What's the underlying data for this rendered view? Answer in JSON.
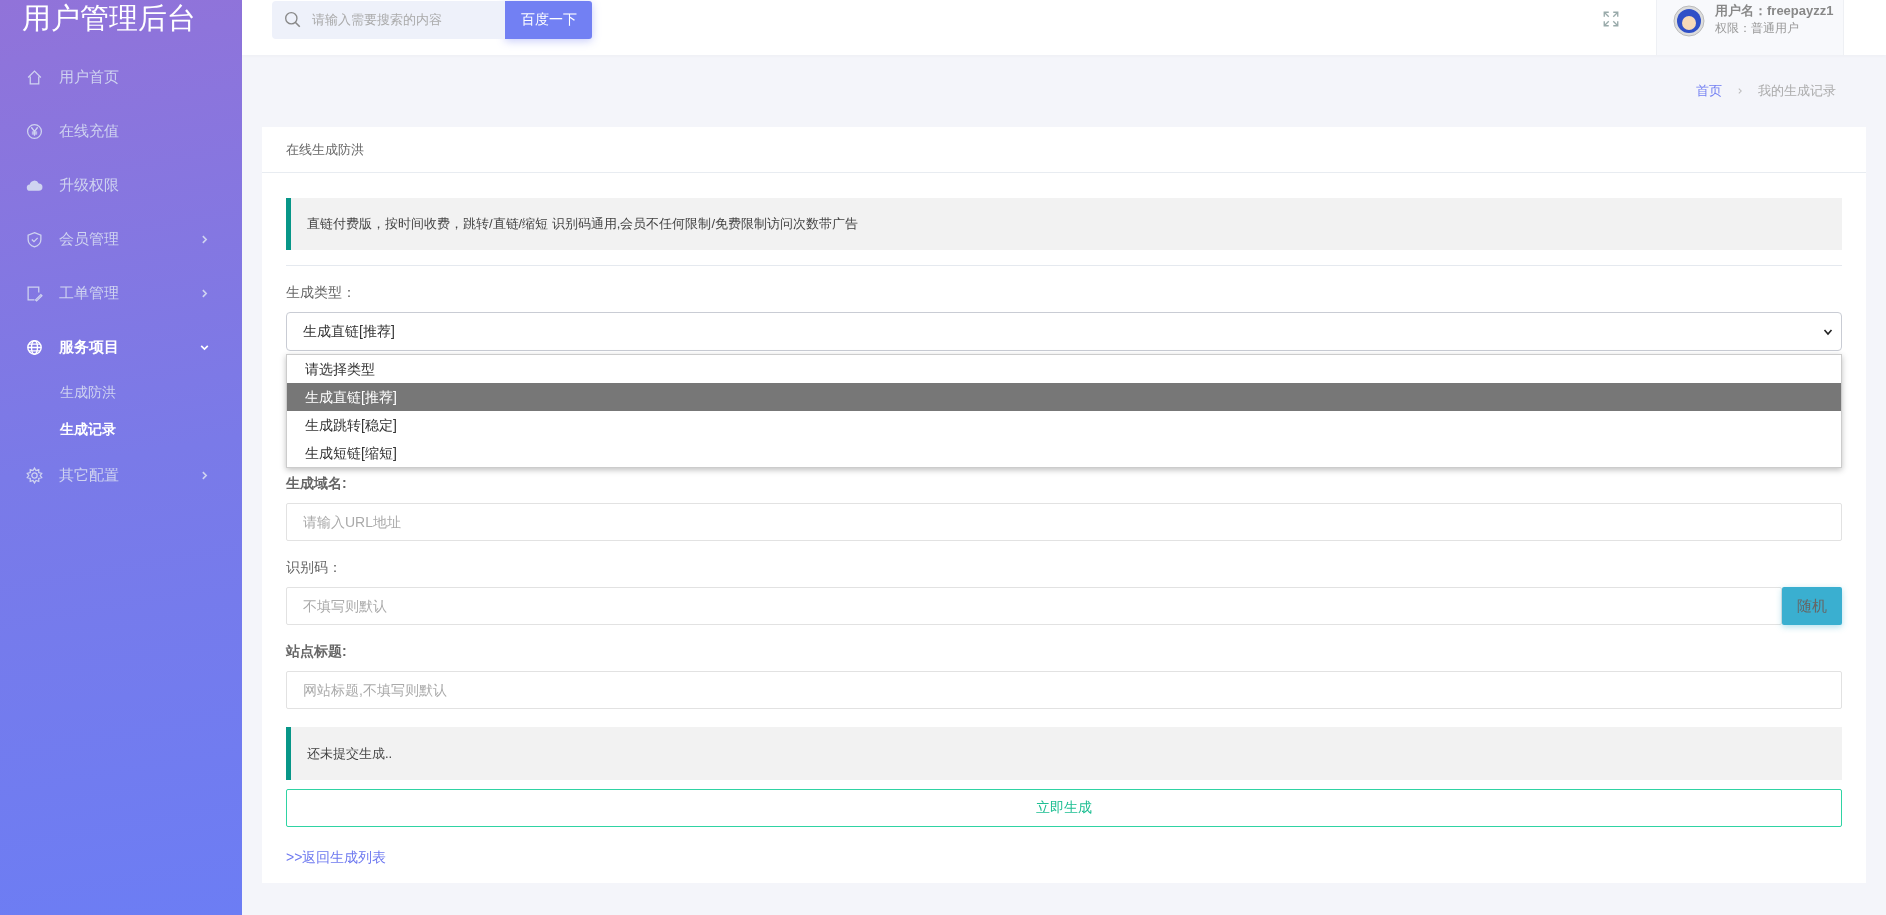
{
  "sidebar": {
    "title": "用户管理后台",
    "items": [
      {
        "label": "用户首页",
        "selected": false
      },
      {
        "label": "在线充值",
        "selected": false
      },
      {
        "label": "升级权限",
        "selected": false
      },
      {
        "label": "会员管理",
        "selected": false,
        "expanded": false
      },
      {
        "label": "工单管理",
        "selected": false,
        "expanded": false
      },
      {
        "label": "服务项目",
        "selected": true,
        "expanded": true,
        "children": [
          {
            "label": "生成防洪",
            "selected": false
          },
          {
            "label": "生成记录",
            "selected": true
          }
        ]
      },
      {
        "label": "其它配置",
        "selected": false,
        "expanded": false
      }
    ]
  },
  "topbar": {
    "search": {
      "placeholder": "请输入需要搜索的内容",
      "button": "百度一下"
    },
    "user": {
      "name": "用户名：freepayzz1",
      "role": "权限：普通用户"
    }
  },
  "breadcrumb": [
    {
      "label": "首页",
      "link": true
    },
    {
      "label": "我的生成记录",
      "link": false
    }
  ],
  "card": {
    "title": "在线生成防洪",
    "notice": "直链付费版，按时间收费，跳转/直链/缩短 识别码通用,会员不任何限制/免费限制访问次数带广告",
    "type_select": {
      "label": "生成类型：",
      "value": "生成直链[推荐]",
      "expanded": true,
      "options": [
        {
          "label": "请选择类型",
          "selected": false
        },
        {
          "label": "生成直链[推荐]",
          "selected": true
        },
        {
          "label": "生成跳转[稳定]",
          "selected": false
        },
        {
          "label": "生成短链[缩短]",
          "selected": false
        }
      ]
    },
    "fields": [
      {
        "label": "生成域名:",
        "placeholder": "请输入URL地址",
        "bold": true
      },
      {
        "label": "识别码：",
        "placeholder": "不填写则默认",
        "bold": false,
        "button": "随机"
      },
      {
        "label": "站点标题:",
        "placeholder": "网站标题,不填写则默认",
        "bold": true
      }
    ],
    "status": "还未提交生成..",
    "submit": "立即生成",
    "back_link": ">>返回生成列表"
  }
}
